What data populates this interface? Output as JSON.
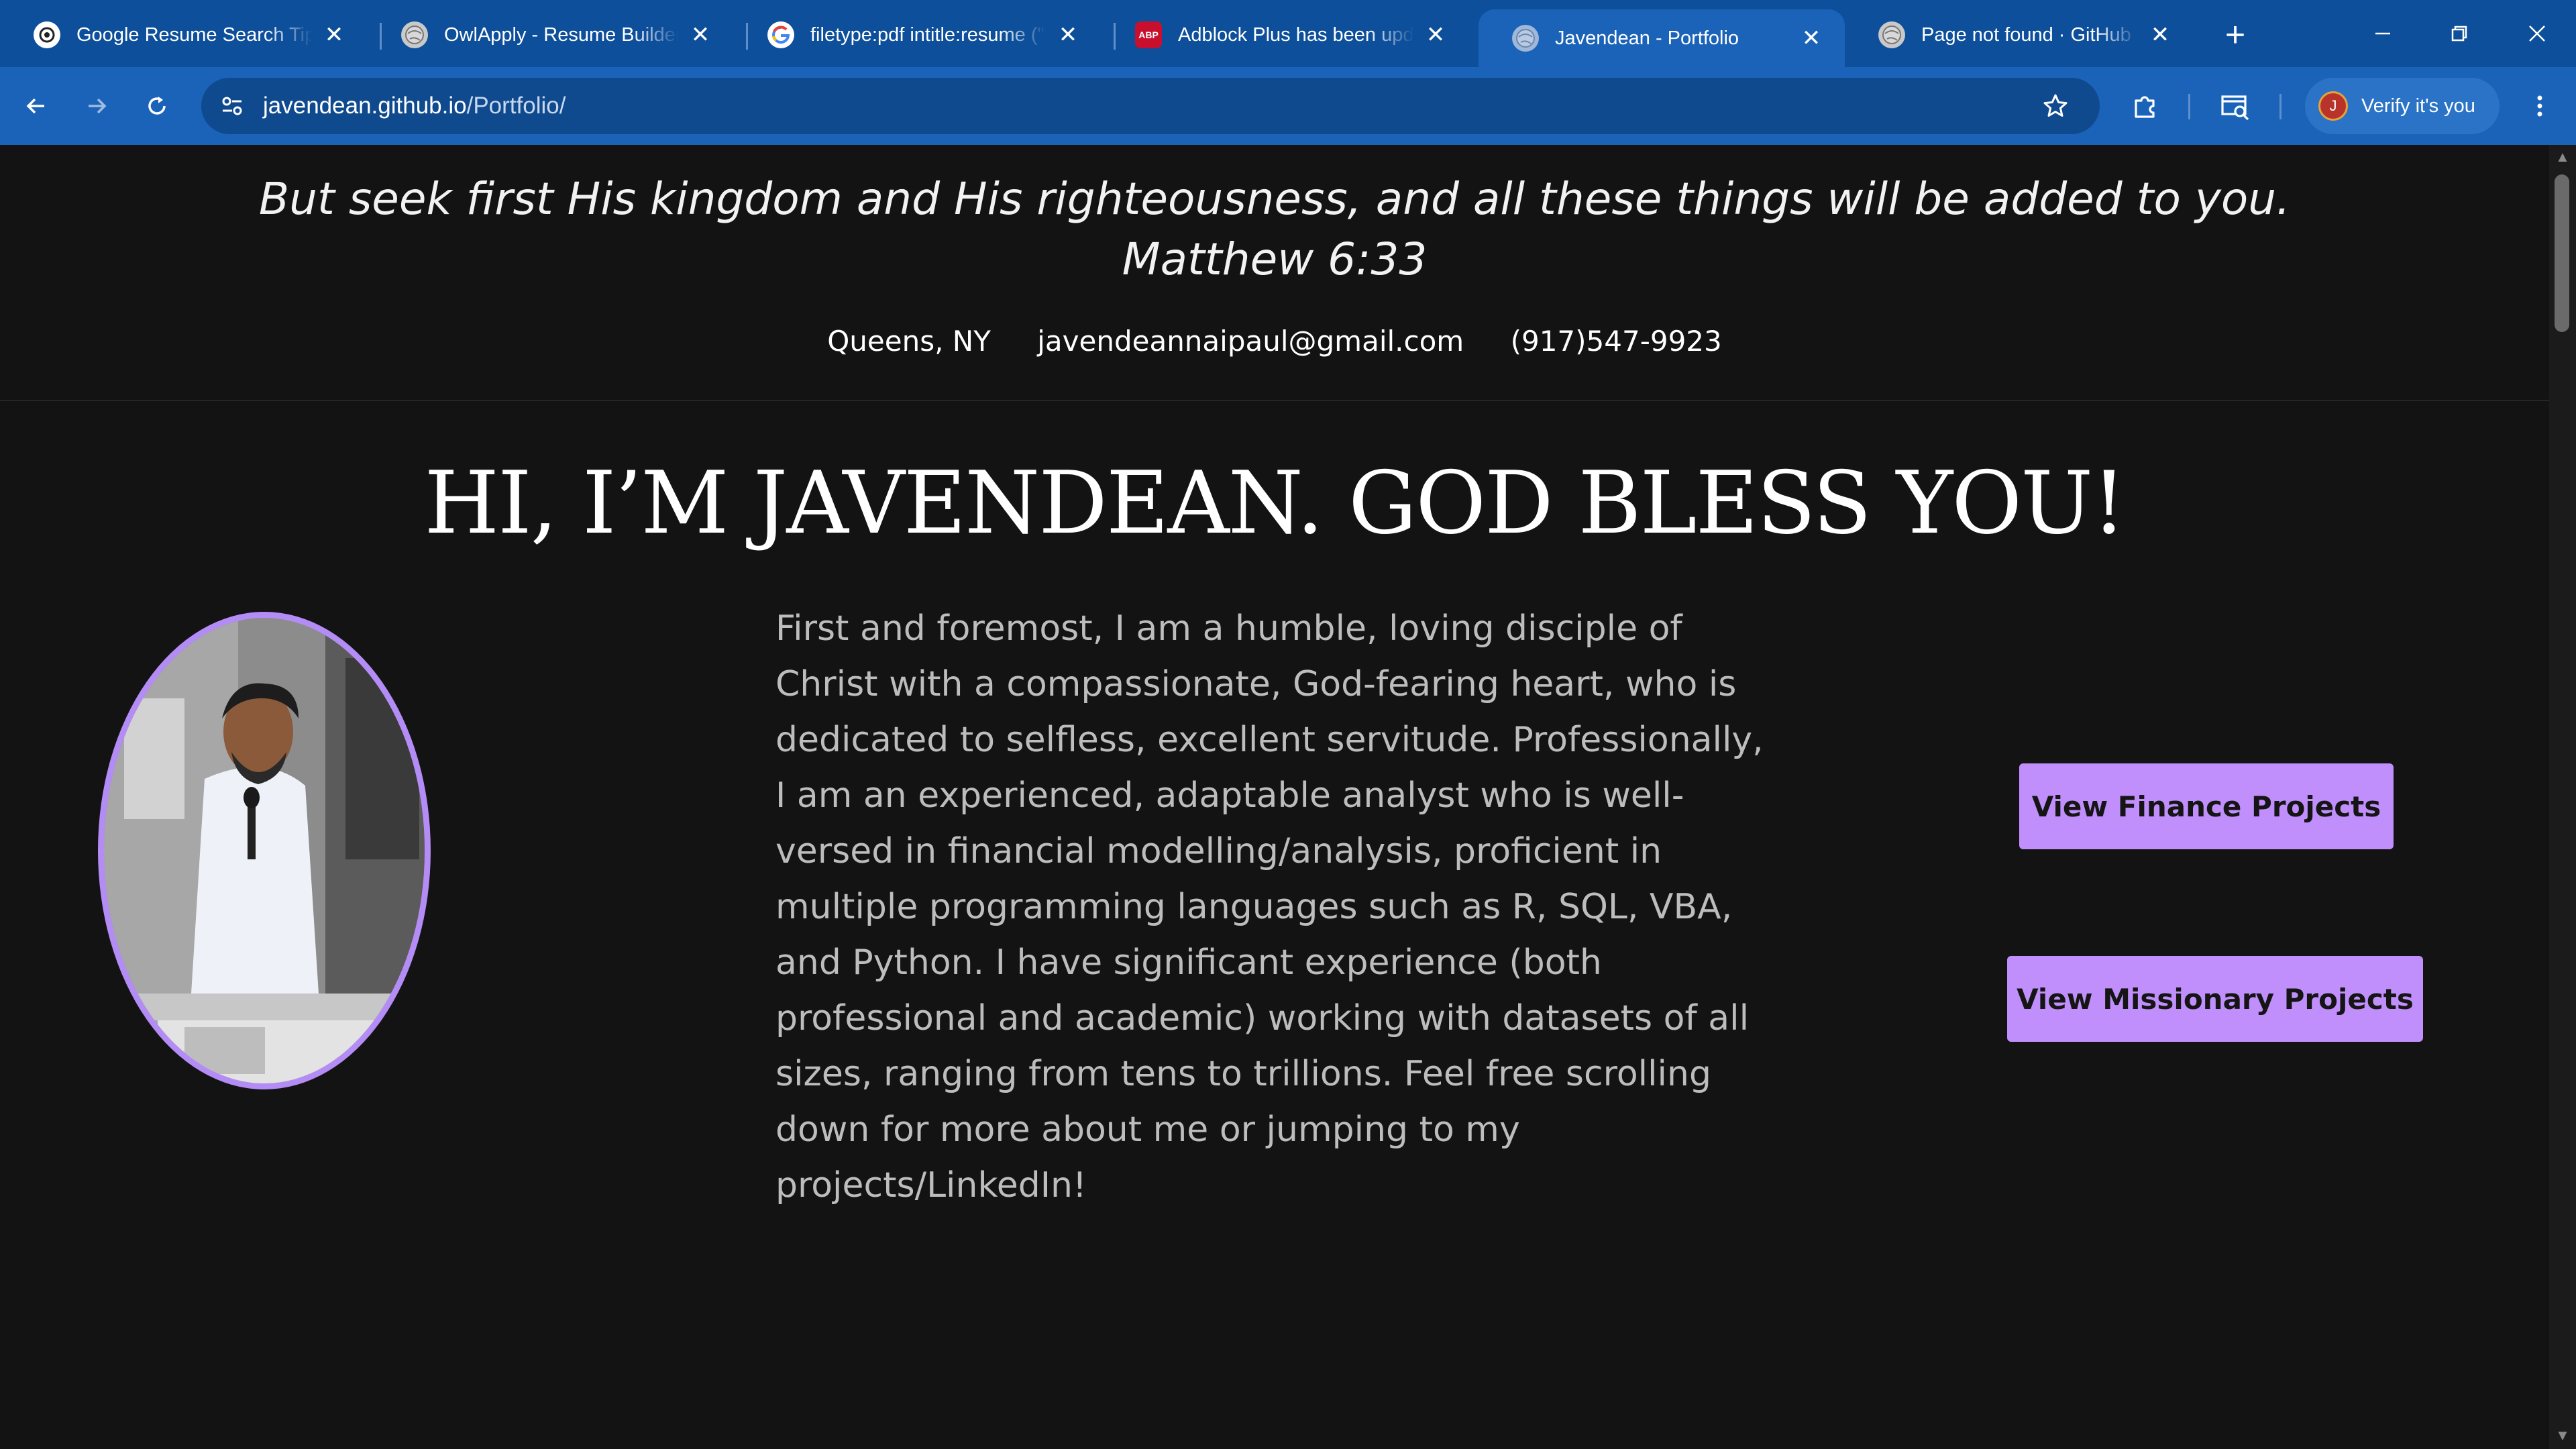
{
  "browser": {
    "tabs": [
      {
        "title": "Google Resume Search Tips",
        "favicon": "chatgpt-icon",
        "active": false
      },
      {
        "title": "OwlApply - Resume Builder",
        "favicon": "globe-icon",
        "active": false
      },
      {
        "title": "filetype:pdf intitle:resume (\"",
        "favicon": "google-icon",
        "active": false
      },
      {
        "title": "Adblock Plus has been upd",
        "favicon": "abp-icon",
        "active": false
      },
      {
        "title": "Javendean - Portfolio",
        "favicon": "globe-icon",
        "active": true
      },
      {
        "title": "Page not found · GitHub Pa",
        "favicon": "globe-icon",
        "active": false
      }
    ],
    "url_host": "javendean.github.io",
    "url_path": "/Portfolio/",
    "profile_button": "Verify it's you",
    "profile_initial": "J",
    "abp_label": "ABP"
  },
  "page": {
    "verse_line1": "But seek first His kingdom and His righteousness, and all these things will be added to you.",
    "verse_line2": "Matthew 6:33",
    "contact": {
      "location": "Queens, NY",
      "email": "javendeannaipaul@gmail.com",
      "phone": "(917)547-9923"
    },
    "heading": "HI, I’M JAVENDEAN. GOD BLESS YOU!",
    "bio": "First and foremost, I am a humble, loving disciple of Christ with a compassionate, God-fearing heart, who is dedicated to selfless, excellent servitude. Professionally, I am an experienced, adaptable analyst who is well-versed in financial modelling/analysis, proficient in multiple programming languages such as R, SQL, VBA, and Python. I have significant experience (both professional and academic) working with datasets of all sizes, ranging from tens to trillions. Feel free scrolling down for more about me or jumping to my projects/LinkedIn!",
    "buttons": {
      "finance": "View Finance Projects",
      "missionary": "View Missionary Projects"
    }
  },
  "colors": {
    "accent": "#c08ffb",
    "portrait_border": "#b48cf5",
    "background": "#131313",
    "browser_frame": "#1a63b8"
  }
}
